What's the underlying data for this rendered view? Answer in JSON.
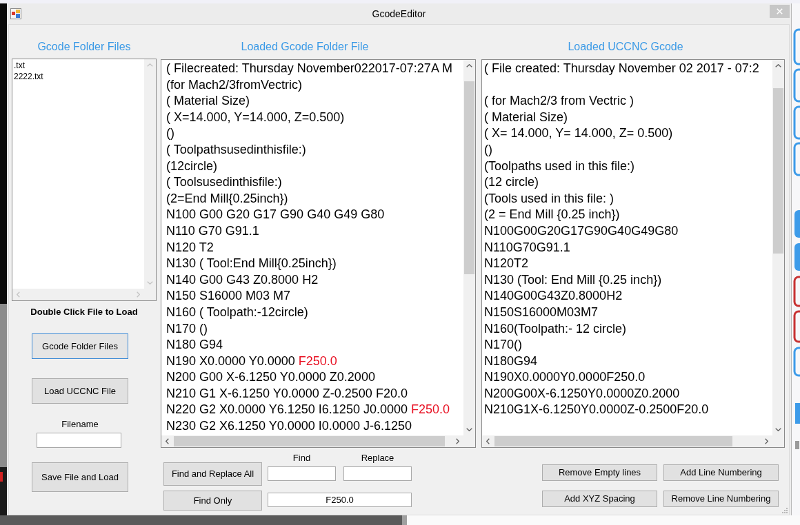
{
  "window": {
    "title": "GcodeEditor"
  },
  "file_panel": {
    "heading": "Gcode Folder Files",
    "files": [
      {
        "name": ".txt",
        "selected": false
      },
      {
        "name": "2222.txt",
        "selected": false
      }
    ],
    "hint": "Double Click File to Load",
    "buttons": [
      {
        "label": "Gcode Folder Files",
        "focused": true
      },
      {
        "label": "Load UCCNC File",
        "focused": false
      }
    ],
    "filename": {
      "label": "Filename"
    },
    "save_button": {
      "label": "Save File and Load"
    }
  },
  "loaded_file": {
    "heading": "Loaded Gcode Folder File",
    "lines": [
      {
        "parts": [
          {
            "text": "( Filecreated: Thursday November022017-07:27A M",
            "highlighted": false
          }
        ]
      },
      {
        "parts": [
          {
            "text": "(for Mach2/3fromVectric)",
            "highlighted": false
          }
        ]
      },
      {
        "parts": [
          {
            "text": "( Material Size)",
            "highlighted": false
          }
        ]
      },
      {
        "parts": [
          {
            "text": "( X=14.000, Y=14.000, Z=0.500)",
            "highlighted": false
          }
        ]
      },
      {
        "parts": [
          {
            "text": "()",
            "highlighted": false
          }
        ]
      },
      {
        "parts": [
          {
            "text": "( Toolpathsusedinthisfile:)",
            "highlighted": false
          }
        ]
      },
      {
        "parts": [
          {
            "text": "(12circle)",
            "highlighted": false
          }
        ]
      },
      {
        "parts": [
          {
            "text": "( Toolsusedinthisfile:)",
            "highlighted": false
          }
        ]
      },
      {
        "parts": [
          {
            "text": "(2=End Mill{0.25inch})",
            "highlighted": false
          }
        ]
      },
      {
        "parts": [
          {
            "text": "N100 G00 G20 G17 G90 G40 G49 G80",
            "highlighted": false
          }
        ]
      },
      {
        "parts": [
          {
            "text": "N110 G70 G91.1",
            "highlighted": false
          }
        ]
      },
      {
        "parts": [
          {
            "text": "N120 T2",
            "highlighted": false
          }
        ]
      },
      {
        "parts": [
          {
            "text": "N130 ( Tool:End Mill{0.25inch})",
            "highlighted": false
          }
        ]
      },
      {
        "parts": [
          {
            "text": "N140 G00 G43 Z0.8000 H2",
            "highlighted": false
          }
        ]
      },
      {
        "parts": [
          {
            "text": "N150 S16000 M03 M7",
            "highlighted": false
          }
        ]
      },
      {
        "parts": [
          {
            "text": "N160 ( Toolpath:-12circle)",
            "highlighted": false
          }
        ]
      },
      {
        "parts": [
          {
            "text": "N170 ()",
            "highlighted": false
          }
        ]
      },
      {
        "parts": [
          {
            "text": "N180 G94",
            "highlighted": false
          }
        ]
      },
      {
        "parts": [
          {
            "text": "N190 X0.0000 Y0.0000 ",
            "highlighted": false
          },
          {
            "text": "F250.0",
            "highlighted": true
          }
        ]
      },
      {
        "parts": [
          {
            "text": "N200 G00 X-6.1250 Y0.0000 Z0.2000",
            "highlighted": false
          }
        ]
      },
      {
        "parts": [
          {
            "text": "N210 G1 X-6.1250 Y0.0000 Z-0.2500 F20.0",
            "highlighted": false
          }
        ]
      },
      {
        "parts": [
          {
            "text": "N220 G2 X0.0000 Y6.1250 I6.1250 J0.0000 ",
            "highlighted": false
          },
          {
            "text": "F250.0",
            "highlighted": true
          }
        ]
      },
      {
        "parts": [
          {
            "text": "N230 G2 X6.1250 Y0.0000 I0.0000 J-6.1250",
            "highlighted": false
          }
        ]
      }
    ]
  },
  "find_replace": {
    "buttons": [
      "Find and Replace All",
      "Find Only"
    ],
    "find": {
      "label": "Find"
    },
    "replace": {
      "label": "Replace"
    },
    "search_field": {
      "value": "F250.0"
    }
  },
  "uccnc_file": {
    "heading": "Loaded UCCNC Gcode",
    "lines": [
      {
        "kind": "text",
        "text": "( File created: Thursday November 02 2017 - 07:2"
      },
      {
        "kind": "blank"
      },
      {
        "kind": "text",
        "text": "( for Mach2/3 from Vectric )"
      },
      {
        "kind": "text",
        "text": "( Material Size)"
      },
      {
        "kind": "text",
        "text": "( X= 14.000, Y= 14.000, Z= 0.500)"
      },
      {
        "kind": "text",
        "text": "()"
      },
      {
        "kind": "text",
        "text": "(Toolpaths used in this file:)"
      },
      {
        "kind": "text",
        "text": "(12 circle)"
      },
      {
        "kind": "text",
        "text": "(Tools used in this file: )"
      },
      {
        "kind": "text",
        "text": "(2 = End Mill {0.25 inch})"
      },
      {
        "kind": "text",
        "text": "N100G00G20G17G90G40G49G80"
      },
      {
        "kind": "text",
        "text": "N110G70G91.1"
      },
      {
        "kind": "text",
        "text": "N120T2"
      },
      {
        "kind": "text",
        "text": "N130 (Tool: End Mill {0.25 inch})"
      },
      {
        "kind": "text",
        "text": "N140G00G43Z0.8000H2"
      },
      {
        "kind": "text",
        "text": "N150S16000M03M7"
      },
      {
        "kind": "text",
        "text": "N160(Toolpath:- 12 circle)"
      },
      {
        "kind": "text",
        "text": "N170()"
      },
      {
        "kind": "text",
        "text": "N180G94"
      },
      {
        "kind": "text",
        "text": "N190X0.0000Y0.0000F250.0"
      },
      {
        "kind": "text",
        "text": "N200G00X-6.1250Y0.0000Z0.2000"
      },
      {
        "kind": "text",
        "text": "N210G1X-6.1250Y0.0000Z-0.2500F20.0"
      }
    ]
  },
  "tools": {
    "buttons": [
      "Remove Empty lines",
      "Add Line Numbering",
      "Add XYZ Spacing",
      "Remove Line Numbering"
    ]
  }
}
